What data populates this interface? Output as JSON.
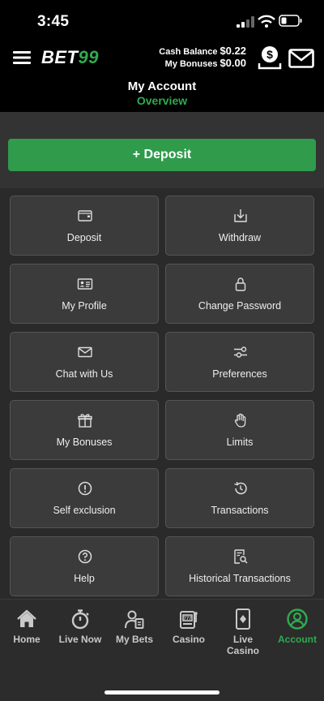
{
  "status": {
    "time": "3:45"
  },
  "brand": {
    "logo_a": "BET",
    "logo_b": "99"
  },
  "balances": {
    "cash_label": "Cash Balance",
    "cash_value": "$0.22",
    "bonus_label": "My Bonuses",
    "bonus_value": "$0.00"
  },
  "page": {
    "title": "My Account",
    "subtitle": "Overview"
  },
  "deposit_button": "+ Deposit",
  "tiles": [
    {
      "label": "Deposit",
      "icon": "wallet-icon"
    },
    {
      "label": "Withdraw",
      "icon": "withdraw-icon"
    },
    {
      "label": "My Profile",
      "icon": "id-card-icon"
    },
    {
      "label": "Change Password",
      "icon": "lock-icon"
    },
    {
      "label": "Chat with Us",
      "icon": "envelope-icon"
    },
    {
      "label": "Preferences",
      "icon": "sliders-icon"
    },
    {
      "label": "My Bonuses",
      "icon": "gift-icon"
    },
    {
      "label": "Limits",
      "icon": "hand-icon"
    },
    {
      "label": "Self exclusion",
      "icon": "info-icon"
    },
    {
      "label": "Transactions",
      "icon": "history-icon"
    },
    {
      "label": "Help",
      "icon": "question-icon"
    },
    {
      "label": "Historical Transactions",
      "icon": "search-receipt-icon"
    }
  ],
  "tabs": [
    {
      "label": "Home",
      "icon": "home-icon"
    },
    {
      "label": "Live Now",
      "icon": "stopwatch-icon"
    },
    {
      "label": "My Bets",
      "icon": "bet-slip-icon"
    },
    {
      "label": "Casino",
      "icon": "slot-machine-icon"
    },
    {
      "label": "Live Casino",
      "icon": "card-icon"
    },
    {
      "label": "Account",
      "icon": "account-icon"
    }
  ],
  "colors": {
    "brand_green": "#2faa4f",
    "deposit_green": "#2f9b4b",
    "tile_bg": "#3b3b3b"
  }
}
